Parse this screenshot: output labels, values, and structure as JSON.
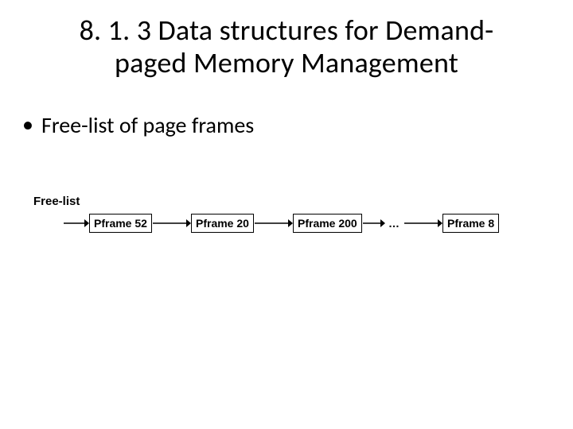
{
  "title_line1": "8. 1. 3 Data structures for Demand-",
  "title_line2": "paged Memory Management",
  "bullet1": "Free-list of page frames",
  "diagram": {
    "label": "Free-list",
    "nodes": [
      "Pframe 52",
      "Pframe 20",
      "Pframe 200",
      "Pframe 8"
    ],
    "ellipsis": "…"
  }
}
